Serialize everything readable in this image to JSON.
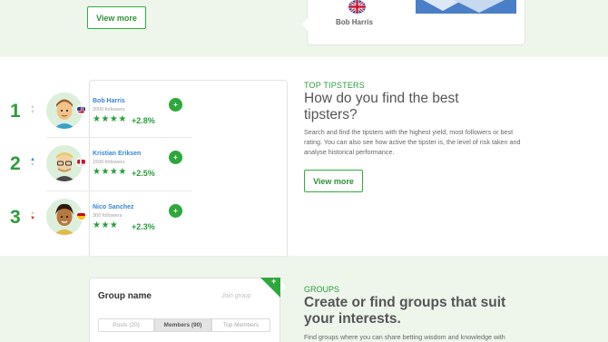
{
  "top": {
    "view_more_label": "View more",
    "card_name": "Bob Harris"
  },
  "tipsters_section": {
    "kicker": "TOP TIPSTERS",
    "heading": "How do you find the best tipsters?",
    "body": "Search and find the tipsters with the highest yield, most followers or best rating. You can also see how active the tipster is, the level of risk taken and analyse historical performance.",
    "view_more_label": "View more",
    "tipsters": [
      {
        "rank": "1",
        "name": "Bob Harris",
        "followers": "2000 followers",
        "stars": "★★★★",
        "yield": "+2.8%",
        "trend": "none",
        "flag": "uk-flag-icon"
      },
      {
        "rank": "2",
        "name": "Kristian Eriksen",
        "followers": "1500 followers",
        "stars": "★★★★",
        "yield": "+2.5%",
        "trend": "up",
        "flag": "denmark-flag-icon"
      },
      {
        "rank": "3",
        "name": "Nico Sanchez",
        "followers": "300 followers",
        "stars": "★★★",
        "yield": "+2.3%",
        "trend": "down",
        "flag": "spain-flag-icon"
      }
    ]
  },
  "groups_section": {
    "kicker": "GROUPS",
    "heading": "Create or find groups that suit your interests.",
    "body": "Find groups where you can share betting wisdom and knowledge with other tipsters who share the same passion as",
    "card": {
      "title": "Group name",
      "join_label": "Join group",
      "tabs": [
        "Posts (20)",
        "Members (90)",
        "Top Members"
      ],
      "active_tab": "Members (90)"
    }
  },
  "colors": {
    "accent_green": "#2ea83b",
    "link_blue": "#3a86d4",
    "background_mint": "#eef6ec"
  }
}
